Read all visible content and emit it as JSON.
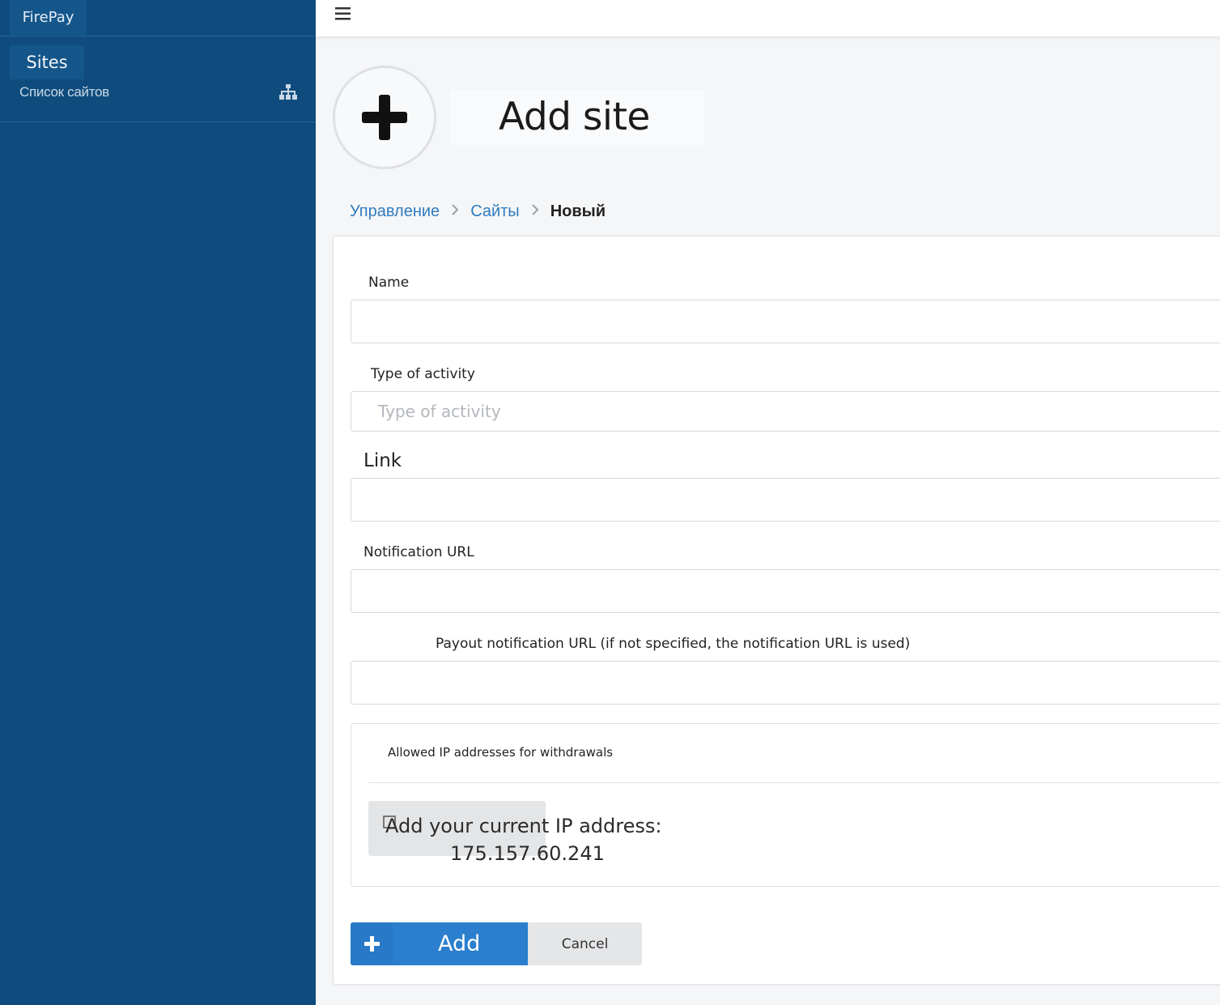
{
  "sidebar": {
    "brand": "FirePay",
    "section_title": "Sites",
    "items": [
      {
        "label": "Список сайтов",
        "icon": "sitemap-icon"
      }
    ]
  },
  "topbar": {
    "menu_icon": "hamburger-icon"
  },
  "header": {
    "icon": "plus-circle-icon",
    "title": "Add site"
  },
  "breadcrumb": {
    "items": [
      {
        "label": "Управление"
      },
      {
        "label": "Сайты"
      },
      {
        "label": "Новый"
      }
    ]
  },
  "form": {
    "name": {
      "label": "Name",
      "value": "",
      "placeholder": ""
    },
    "type_of_activity": {
      "label": "Type of activity",
      "value": "",
      "placeholder": "Type of activity"
    },
    "link": {
      "label": "Link",
      "value": "",
      "placeholder": ""
    },
    "notification_url": {
      "label": "Notification URL",
      "value": "",
      "placeholder": ""
    },
    "payout_notification_url": {
      "label": "Payout notification URL (if not specified, the notification URL is used)",
      "value": "",
      "placeholder": ""
    },
    "allowed_ips": {
      "title": "Allowed IP addresses for withdrawals",
      "add_current_label": "Add your current IP address:",
      "current_ip": "175.157.60.241"
    }
  },
  "actions": {
    "add_label": "Add",
    "cancel_label": "Cancel"
  },
  "colors": {
    "sidebar_bg": "#0f4c7d",
    "primary": "#2b7fce",
    "link": "#2f7bbf"
  }
}
